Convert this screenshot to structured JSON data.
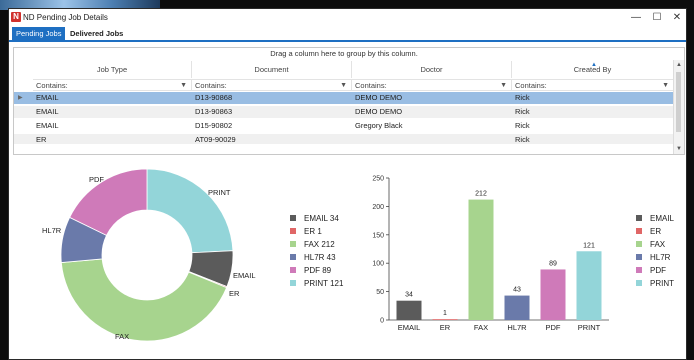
{
  "window": {
    "title": "ND Pending Job Details",
    "icon_letter": "N",
    "minimize": "—",
    "maximize": "☐",
    "close": "✕"
  },
  "tabs": [
    {
      "label": "Pending Jobs",
      "active": true
    },
    {
      "label": "Delivered Jobs",
      "active": false
    }
  ],
  "grid": {
    "group_hint": "Drag a column here to group by this column.",
    "columns": [
      "Job Type",
      "Document",
      "Doctor",
      "Created By"
    ],
    "sorted_column": "Created By",
    "filter_placeholder": "Contains:",
    "rows": [
      {
        "job_type": "EMAIL",
        "document": "D13-90868",
        "doctor": "DEMO DEMO",
        "created_by": "Rick",
        "selected": true
      },
      {
        "job_type": "EMAIL",
        "document": "D13-90863",
        "doctor": "DEMO DEMO",
        "created_by": "Rick",
        "selected": false
      },
      {
        "job_type": "EMAIL",
        "document": "D15-90802",
        "doctor": "Gregory Black",
        "created_by": "Rick",
        "selected": false
      },
      {
        "job_type": "ER",
        "document": "AT09-90029",
        "doctor": "",
        "created_by": "Rick",
        "selected": false
      }
    ]
  },
  "colors": {
    "EMAIL": "#5b5b5b",
    "ER": "#e06666",
    "FAX": "#a7d48e",
    "HL7R": "#6a7aaa",
    "PDF": "#cf7ab9",
    "PRINT": "#93d5d9"
  },
  "chart_data": [
    {
      "type": "pie",
      "categories": [
        "EMAIL",
        "ER",
        "FAX",
        "HL7R",
        "PDF",
        "PRINT"
      ],
      "values": [
        34,
        1,
        212,
        43,
        89,
        121
      ],
      "legend": [
        "EMAIL 34",
        "ER 1",
        "FAX 212",
        "HL7R 43",
        "PDF 89",
        "PRINT 121"
      ],
      "legend_position": "right"
    },
    {
      "type": "bar",
      "categories": [
        "EMAIL",
        "ER",
        "FAX",
        "HL7R",
        "PDF",
        "PRINT"
      ],
      "values": [
        34,
        1,
        212,
        43,
        89,
        121
      ],
      "ylim": [
        0,
        250
      ],
      "yticks": [
        "0",
        "50",
        "100",
        "150",
        "200",
        "250"
      ],
      "legend": [
        "EMAIL",
        "ER",
        "FAX",
        "HL7R",
        "PDF",
        "PRINT"
      ],
      "legend_position": "right"
    }
  ]
}
